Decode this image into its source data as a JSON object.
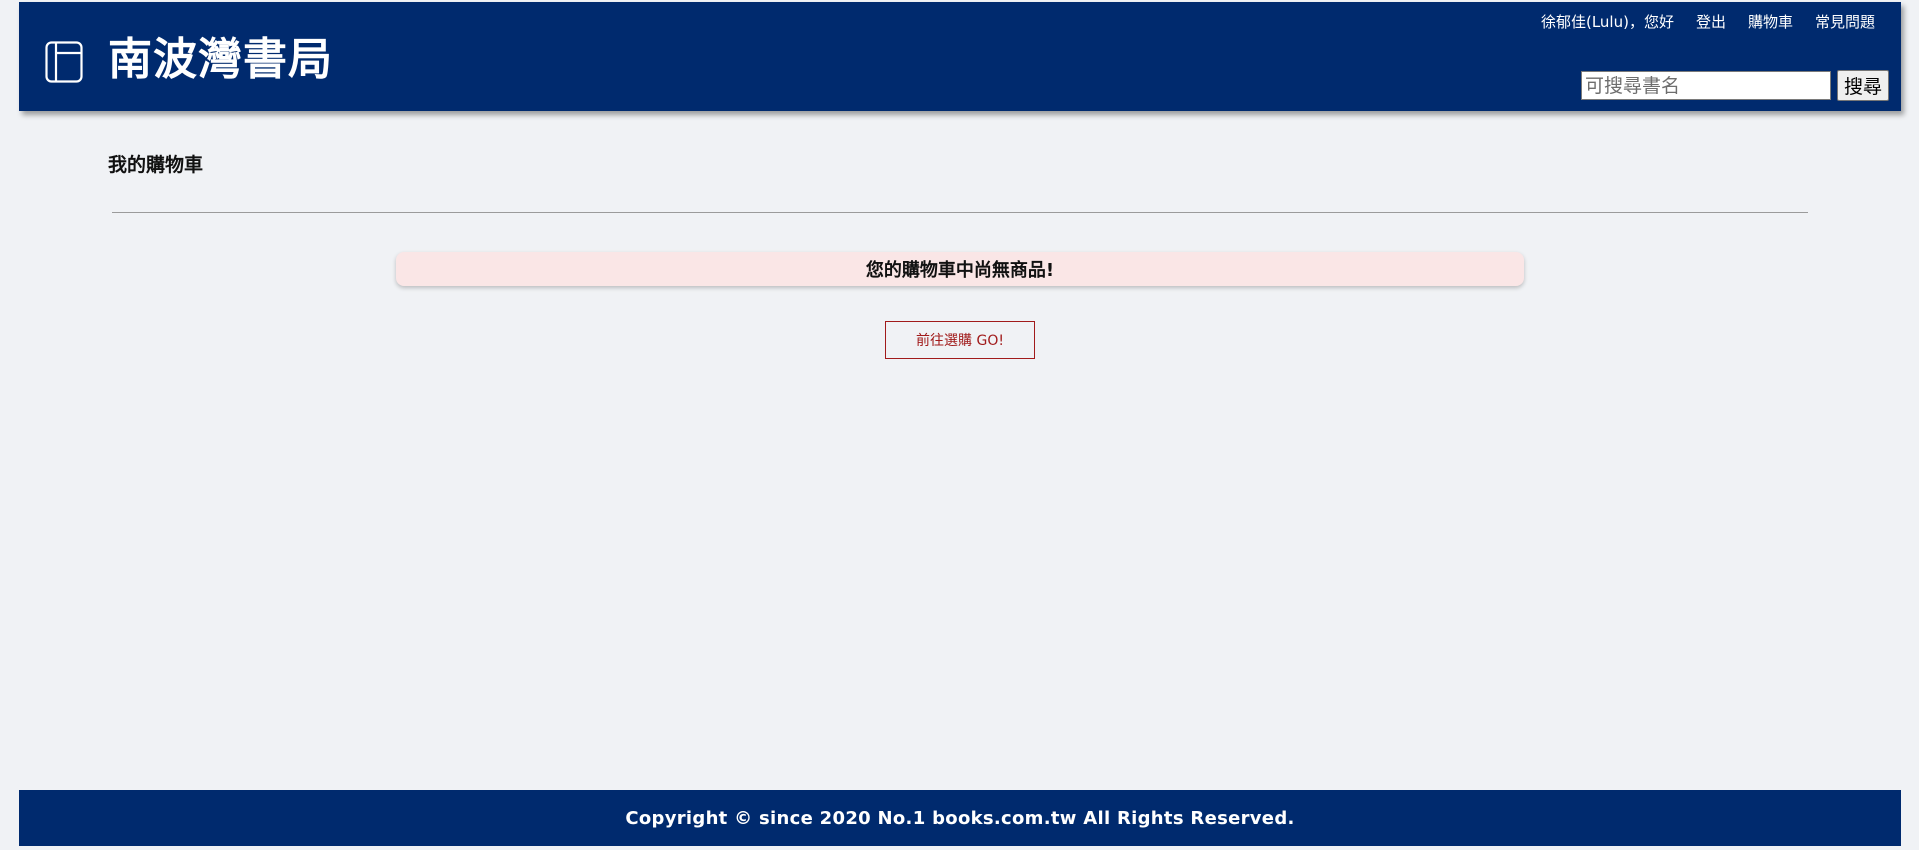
{
  "header": {
    "brand_title": "南波灣書局",
    "logo_icon": "book-icon",
    "greeting": "徐郁佳(Lulu)，您好",
    "nav": {
      "logout": "登出",
      "cart": "購物車",
      "faq": "常見問題"
    },
    "search": {
      "placeholder": "可搜尋書名",
      "button_label": "搜尋"
    }
  },
  "main": {
    "page_title": "我的購物車",
    "empty_message": "您的購物車中尚無商品!",
    "go_shop_label": "前往選購 GO!"
  },
  "footer": {
    "copyright": "Copyright © since 2020 No.1 books.com.tw All Rights Reserved."
  },
  "colors": {
    "brand_navy": "#002a6e",
    "page_bg": "#f0f2f5",
    "alert_bg": "#fae6e6",
    "accent_red": "#a11b1b"
  }
}
